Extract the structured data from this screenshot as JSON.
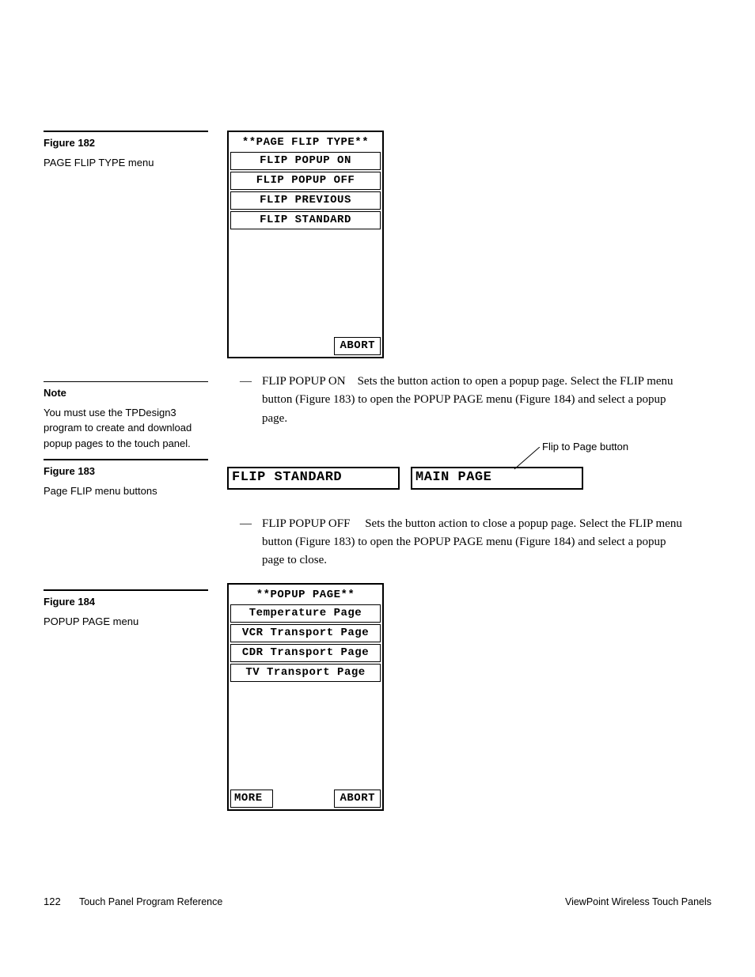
{
  "figure182": {
    "label": "Figure 182",
    "caption": "PAGE FLIP TYPE menu",
    "menu": {
      "title": "**PAGE FLIP TYPE**",
      "items": [
        "FLIP POPUP ON",
        "FLIP POPUP OFF",
        "FLIP PREVIOUS",
        "FLIP STANDARD"
      ],
      "abort": "ABORT"
    }
  },
  "note": {
    "label": "Note",
    "text": "You must use the TPDesign3 program to create and download popup pages to the touch panel."
  },
  "para1": {
    "lead": "FLIP POPUP ON",
    "rest": "Sets the button action to open a popup page. Select the FLIP menu button (Figure 183) to open the POPUP PAGE menu (Figure 184) and select a popup page."
  },
  "figure183": {
    "label": "Figure 183",
    "caption": "Page FLIP menu buttons",
    "callout": "Flip to Page button",
    "btn1": "FLIP STANDARD",
    "btn2": "MAIN PAGE"
  },
  "para2": {
    "lead": "FLIP POPUP OFF",
    "rest": "Sets the button action to close a popup page. Select the FLIP menu button (Figure 183) to open the POPUP PAGE menu (Figure 184) and select a popup page to close."
  },
  "figure184": {
    "label": "Figure 184",
    "caption": "POPUP PAGE menu",
    "menu": {
      "title": "**POPUP PAGE**",
      "items": [
        "Temperature Page",
        "VCR Transport Page",
        "CDR Transport Page",
        "TV Transport Page"
      ],
      "more": "MORE",
      "abort": "ABORT"
    }
  },
  "footer": {
    "page": "122",
    "left": "Touch Panel Program Reference",
    "right": "ViewPoint Wireless Touch Panels"
  }
}
